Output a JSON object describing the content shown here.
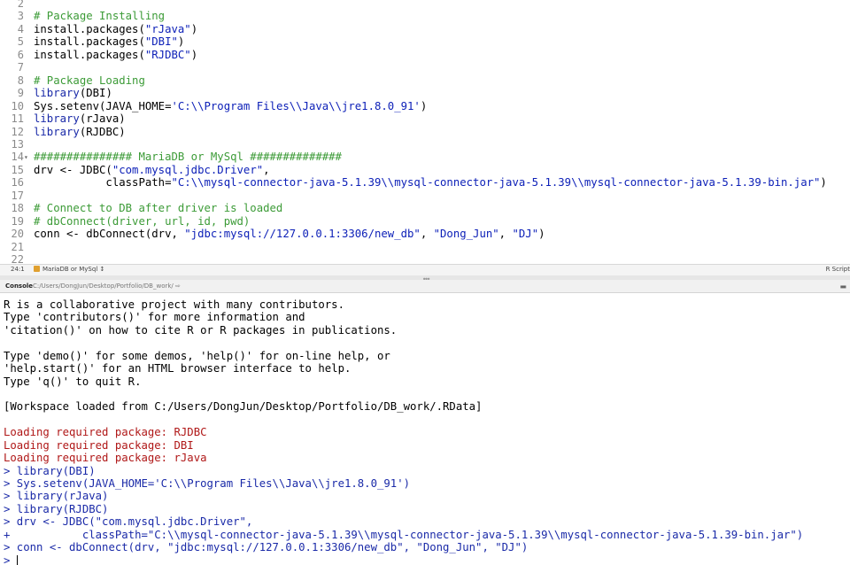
{
  "editor": {
    "lines": [
      {
        "n": "2",
        "t": "",
        "c": "pl"
      },
      {
        "n": "3",
        "t": "# Package Installing",
        "c": "cm"
      },
      {
        "n": "4",
        "t": "install.packages(\"rJava\")",
        "c": "mix",
        "parts": [
          [
            "install.packages(",
            "pl"
          ],
          [
            "\"rJava\"",
            "str"
          ],
          [
            ")",
            "pl"
          ]
        ]
      },
      {
        "n": "5",
        "t": "install.packages(\"DBI\")",
        "c": "mix",
        "parts": [
          [
            "install.packages(",
            "pl"
          ],
          [
            "\"DBI\"",
            "str"
          ],
          [
            ")",
            "pl"
          ]
        ]
      },
      {
        "n": "6",
        "t": "install.packages(\"RJDBC\")",
        "c": "mix",
        "parts": [
          [
            "install.packages(",
            "pl"
          ],
          [
            "\"RJDBC\"",
            "str"
          ],
          [
            ")",
            "pl"
          ]
        ]
      },
      {
        "n": "7",
        "t": "",
        "c": "pl"
      },
      {
        "n": "8",
        "t": "# Package Loading",
        "c": "cm"
      },
      {
        "n": "9",
        "t": "library(DBI)",
        "c": "mix",
        "parts": [
          [
            "library",
            "kw"
          ],
          [
            "(DBI)",
            "pl"
          ]
        ]
      },
      {
        "n": "10",
        "t": "Sys.setenv(JAVA_HOME='C:\\\\Program Files\\\\Java\\\\jre1.8.0_91')",
        "c": "mix",
        "parts": [
          [
            "Sys.setenv(JAVA_HOME=",
            "pl"
          ],
          [
            "'C:\\\\Program Files\\\\Java\\\\jre1.8.0_91'",
            "str"
          ],
          [
            ")",
            "pl"
          ]
        ]
      },
      {
        "n": "11",
        "t": "library(rJava)",
        "c": "mix",
        "parts": [
          [
            "library",
            "kw"
          ],
          [
            "(rJava)",
            "pl"
          ]
        ]
      },
      {
        "n": "12",
        "t": "library(RJDBC)",
        "c": "mix",
        "parts": [
          [
            "library",
            "kw"
          ],
          [
            "(RJDBC)",
            "pl"
          ]
        ]
      },
      {
        "n": "13",
        "t": "",
        "c": "pl"
      },
      {
        "n": "14",
        "t": "############### MariaDB or MySql ##############",
        "c": "cm",
        "fold": true
      },
      {
        "n": "15",
        "t": "drv <- JDBC(\"com.mysql.jdbc.Driver\",",
        "c": "mix",
        "parts": [
          [
            "drv <- JDBC(",
            "pl"
          ],
          [
            "\"com.mysql.jdbc.Driver\"",
            "str"
          ],
          [
            ",",
            "pl"
          ]
        ]
      },
      {
        "n": "16",
        "t": "           classPath=\"C:\\\\mysql-connector-java-5.1.39\\\\mysql-connector-java-5.1.39\\\\mysql-connector-java-5.1.39-bin.jar\")",
        "c": "mix",
        "parts": [
          [
            "           classPath=",
            "pl"
          ],
          [
            "\"C:\\\\mysql-connector-java-5.1.39\\\\mysql-connector-java-5.1.39\\\\mysql-connector-java-5.1.39-bin.jar\"",
            "str"
          ],
          [
            ")",
            "pl"
          ]
        ]
      },
      {
        "n": "17",
        "t": "",
        "c": "pl"
      },
      {
        "n": "18",
        "t": "# Connect to DB after driver is loaded",
        "c": "cm"
      },
      {
        "n": "19",
        "t": "# dbConnect(driver, url, id, pwd)",
        "c": "cm"
      },
      {
        "n": "20",
        "t": "conn <- dbConnect(drv, \"jdbc:mysql://127.0.0.1:3306/new_db\", \"Dong_Jun\", \"DJ\")",
        "c": "mix",
        "parts": [
          [
            "conn <- dbConnect(drv, ",
            "pl"
          ],
          [
            "\"jdbc:mysql://127.0.0.1:3306/new_db\"",
            "str"
          ],
          [
            ", ",
            "pl"
          ],
          [
            "\"Dong_Jun\"",
            "str"
          ],
          [
            ", ",
            "pl"
          ],
          [
            "\"DJ\"",
            "str"
          ],
          [
            ")",
            "pl"
          ]
        ]
      },
      {
        "n": "21",
        "t": "",
        "c": "pl"
      },
      {
        "n": "22",
        "t": "",
        "c": "pl"
      }
    ],
    "status": {
      "position": "24:1",
      "scope": "MariaDB or MySql",
      "scope_arrow": "↕",
      "filetype": "R Script"
    }
  },
  "console": {
    "title": "Console",
    "path": "C:/Users/DongJun/Desktop/Portfolio/DB_work/",
    "path_arrow": "⇨",
    "clear_icon": "▬",
    "lines": [
      {
        "t": "R is a collaborative project with many contributors.",
        "c": "out"
      },
      {
        "t": "Type 'contributors()' for more information and",
        "c": "out"
      },
      {
        "t": "'citation()' on how to cite R or R packages in publications.",
        "c": "out"
      },
      {
        "t": "",
        "c": "out"
      },
      {
        "t": "Type 'demo()' for some demos, 'help()' for on-line help, or",
        "c": "out"
      },
      {
        "t": "'help.start()' for an HTML browser interface to help.",
        "c": "out"
      },
      {
        "t": "Type 'q()' to quit R.",
        "c": "out"
      },
      {
        "t": "",
        "c": "out"
      },
      {
        "t": "[Workspace loaded from C:/Users/DongJun/Desktop/Portfolio/DB_work/.RData]",
        "c": "out"
      },
      {
        "t": "",
        "c": "out"
      },
      {
        "t": "Loading required package: RJDBC",
        "c": "msg"
      },
      {
        "t": "Loading required package: DBI",
        "c": "msg"
      },
      {
        "t": "Loading required package: rJava",
        "c": "msg"
      },
      {
        "t": "> library(DBI)",
        "c": "inp"
      },
      {
        "t": "> Sys.setenv(JAVA_HOME='C:\\\\Program Files\\\\Java\\\\jre1.8.0_91')",
        "c": "inp"
      },
      {
        "t": "> library(rJava)",
        "c": "inp"
      },
      {
        "t": "> library(RJDBC)",
        "c": "inp"
      },
      {
        "t": "> drv <- JDBC(\"com.mysql.jdbc.Driver\",",
        "c": "inp"
      },
      {
        "t": "+           classPath=\"C:\\\\mysql-connector-java-5.1.39\\\\mysql-connector-java-5.1.39\\\\mysql-connector-java-5.1.39-bin.jar\")",
        "c": "inp"
      },
      {
        "t": "> conn <- dbConnect(drv, \"jdbc:mysql://127.0.0.1:3306/new_db\", \"Dong_Jun\", \"DJ\")",
        "c": "inp"
      },
      {
        "t": "> ",
        "c": "inp",
        "prompt": true
      }
    ]
  }
}
